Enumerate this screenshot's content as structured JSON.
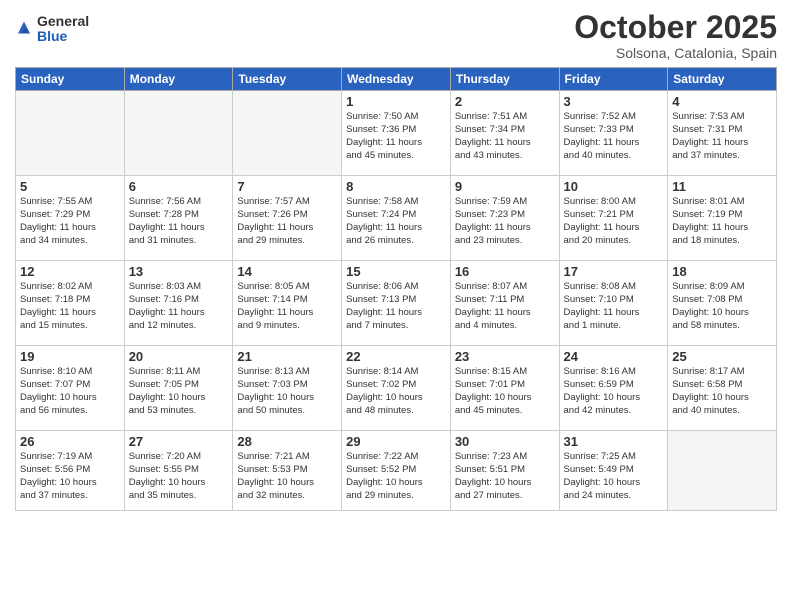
{
  "header": {
    "logo_general": "General",
    "logo_blue": "Blue",
    "month": "October 2025",
    "location": "Solsona, Catalonia, Spain"
  },
  "weekdays": [
    "Sunday",
    "Monday",
    "Tuesday",
    "Wednesday",
    "Thursday",
    "Friday",
    "Saturday"
  ],
  "weeks": [
    [
      {
        "day": "",
        "info": ""
      },
      {
        "day": "",
        "info": ""
      },
      {
        "day": "",
        "info": ""
      },
      {
        "day": "1",
        "info": "Sunrise: 7:50 AM\nSunset: 7:36 PM\nDaylight: 11 hours\nand 45 minutes."
      },
      {
        "day": "2",
        "info": "Sunrise: 7:51 AM\nSunset: 7:34 PM\nDaylight: 11 hours\nand 43 minutes."
      },
      {
        "day": "3",
        "info": "Sunrise: 7:52 AM\nSunset: 7:33 PM\nDaylight: 11 hours\nand 40 minutes."
      },
      {
        "day": "4",
        "info": "Sunrise: 7:53 AM\nSunset: 7:31 PM\nDaylight: 11 hours\nand 37 minutes."
      }
    ],
    [
      {
        "day": "5",
        "info": "Sunrise: 7:55 AM\nSunset: 7:29 PM\nDaylight: 11 hours\nand 34 minutes."
      },
      {
        "day": "6",
        "info": "Sunrise: 7:56 AM\nSunset: 7:28 PM\nDaylight: 11 hours\nand 31 minutes."
      },
      {
        "day": "7",
        "info": "Sunrise: 7:57 AM\nSunset: 7:26 PM\nDaylight: 11 hours\nand 29 minutes."
      },
      {
        "day": "8",
        "info": "Sunrise: 7:58 AM\nSunset: 7:24 PM\nDaylight: 11 hours\nand 26 minutes."
      },
      {
        "day": "9",
        "info": "Sunrise: 7:59 AM\nSunset: 7:23 PM\nDaylight: 11 hours\nand 23 minutes."
      },
      {
        "day": "10",
        "info": "Sunrise: 8:00 AM\nSunset: 7:21 PM\nDaylight: 11 hours\nand 20 minutes."
      },
      {
        "day": "11",
        "info": "Sunrise: 8:01 AM\nSunset: 7:19 PM\nDaylight: 11 hours\nand 18 minutes."
      }
    ],
    [
      {
        "day": "12",
        "info": "Sunrise: 8:02 AM\nSunset: 7:18 PM\nDaylight: 11 hours\nand 15 minutes."
      },
      {
        "day": "13",
        "info": "Sunrise: 8:03 AM\nSunset: 7:16 PM\nDaylight: 11 hours\nand 12 minutes."
      },
      {
        "day": "14",
        "info": "Sunrise: 8:05 AM\nSunset: 7:14 PM\nDaylight: 11 hours\nand 9 minutes."
      },
      {
        "day": "15",
        "info": "Sunrise: 8:06 AM\nSunset: 7:13 PM\nDaylight: 11 hours\nand 7 minutes."
      },
      {
        "day": "16",
        "info": "Sunrise: 8:07 AM\nSunset: 7:11 PM\nDaylight: 11 hours\nand 4 minutes."
      },
      {
        "day": "17",
        "info": "Sunrise: 8:08 AM\nSunset: 7:10 PM\nDaylight: 11 hours\nand 1 minute."
      },
      {
        "day": "18",
        "info": "Sunrise: 8:09 AM\nSunset: 7:08 PM\nDaylight: 10 hours\nand 58 minutes."
      }
    ],
    [
      {
        "day": "19",
        "info": "Sunrise: 8:10 AM\nSunset: 7:07 PM\nDaylight: 10 hours\nand 56 minutes."
      },
      {
        "day": "20",
        "info": "Sunrise: 8:11 AM\nSunset: 7:05 PM\nDaylight: 10 hours\nand 53 minutes."
      },
      {
        "day": "21",
        "info": "Sunrise: 8:13 AM\nSunset: 7:03 PM\nDaylight: 10 hours\nand 50 minutes."
      },
      {
        "day": "22",
        "info": "Sunrise: 8:14 AM\nSunset: 7:02 PM\nDaylight: 10 hours\nand 48 minutes."
      },
      {
        "day": "23",
        "info": "Sunrise: 8:15 AM\nSunset: 7:01 PM\nDaylight: 10 hours\nand 45 minutes."
      },
      {
        "day": "24",
        "info": "Sunrise: 8:16 AM\nSunset: 6:59 PM\nDaylight: 10 hours\nand 42 minutes."
      },
      {
        "day": "25",
        "info": "Sunrise: 8:17 AM\nSunset: 6:58 PM\nDaylight: 10 hours\nand 40 minutes."
      }
    ],
    [
      {
        "day": "26",
        "info": "Sunrise: 7:19 AM\nSunset: 5:56 PM\nDaylight: 10 hours\nand 37 minutes."
      },
      {
        "day": "27",
        "info": "Sunrise: 7:20 AM\nSunset: 5:55 PM\nDaylight: 10 hours\nand 35 minutes."
      },
      {
        "day": "28",
        "info": "Sunrise: 7:21 AM\nSunset: 5:53 PM\nDaylight: 10 hours\nand 32 minutes."
      },
      {
        "day": "29",
        "info": "Sunrise: 7:22 AM\nSunset: 5:52 PM\nDaylight: 10 hours\nand 29 minutes."
      },
      {
        "day": "30",
        "info": "Sunrise: 7:23 AM\nSunset: 5:51 PM\nDaylight: 10 hours\nand 27 minutes."
      },
      {
        "day": "31",
        "info": "Sunrise: 7:25 AM\nSunset: 5:49 PM\nDaylight: 10 hours\nand 24 minutes."
      },
      {
        "day": "",
        "info": ""
      }
    ]
  ]
}
